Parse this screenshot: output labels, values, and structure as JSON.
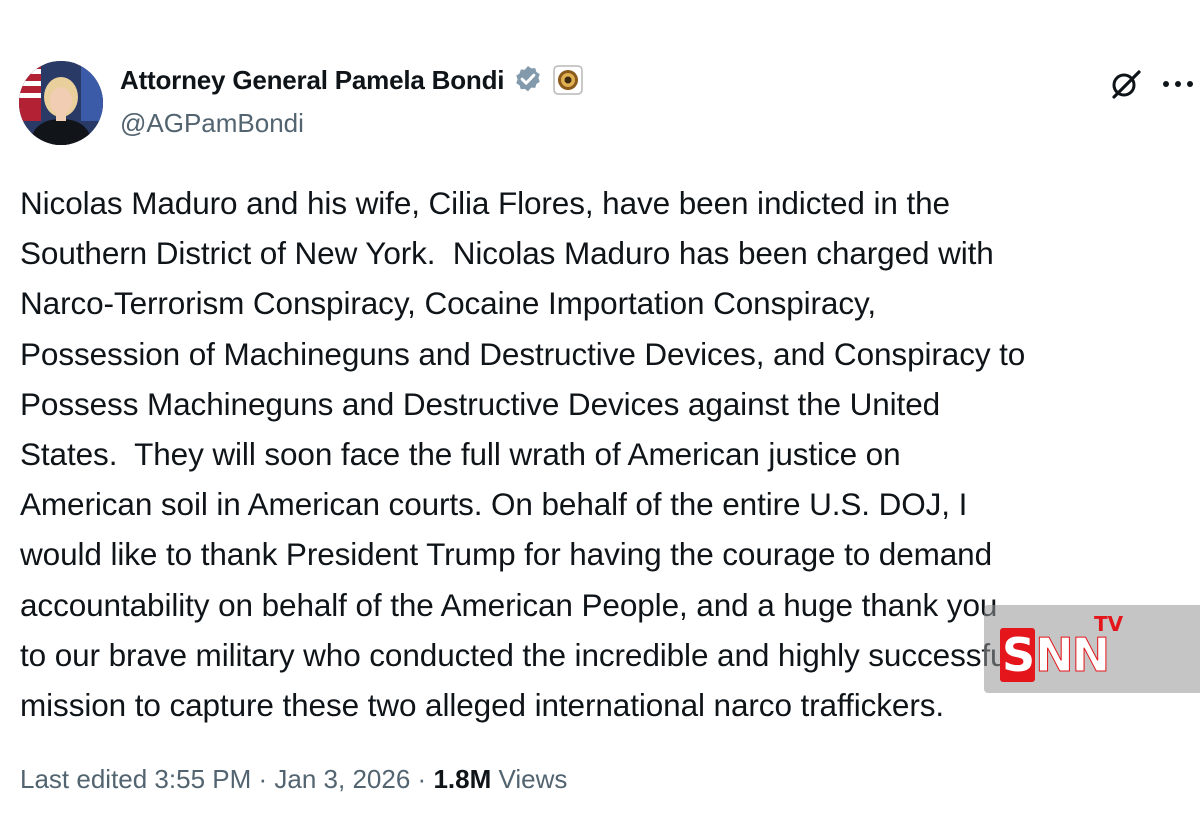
{
  "post": {
    "author_name": "Attorney General Pamela Bondi",
    "author_handle": "@AGPamBondi",
    "text_lines": [
      "Nicolas Maduro and his wife, Cilia Flores, have been indicted in the",
      "Southern District of New York.  Nicolas Maduro has been charged with",
      "Narco-Terrorism Conspiracy, Cocaine Importation Conspiracy,",
      "Possession of Machineguns and Destructive Devices, and Conspiracy to",
      "Possess Machineguns and Destructive Devices against the United",
      "States.  They will soon face the full wrath of American justice on",
      "American soil in American courts. On behalf of the entire U.S. DOJ, I",
      "would like to thank President Trump for having the courage to demand",
      "accountability on behalf of the American People, and a huge thank you",
      "to our brave military who conducted the incredible and highly successful",
      "mission to capture these two alleged international narco traffickers."
    ],
    "edited_label": "Last edited 3:55 PM",
    "separator": "·",
    "date": "Jan 3, 2026",
    "views_count": "1.8M",
    "views_label": "Views"
  },
  "icons": {
    "verified": "verified-badge-icon",
    "affiliate": "doj-seal-icon",
    "grok": "grok-icon",
    "more": "more-icon"
  },
  "colors": {
    "text": "#0f1419",
    "secondary_text": "#536471",
    "verified_badge": "#829aab",
    "watermark_red": "#e4161b"
  },
  "watermark": {
    "logo_s": "S",
    "logo_nn": "NN",
    "logo_tv": "TV"
  }
}
